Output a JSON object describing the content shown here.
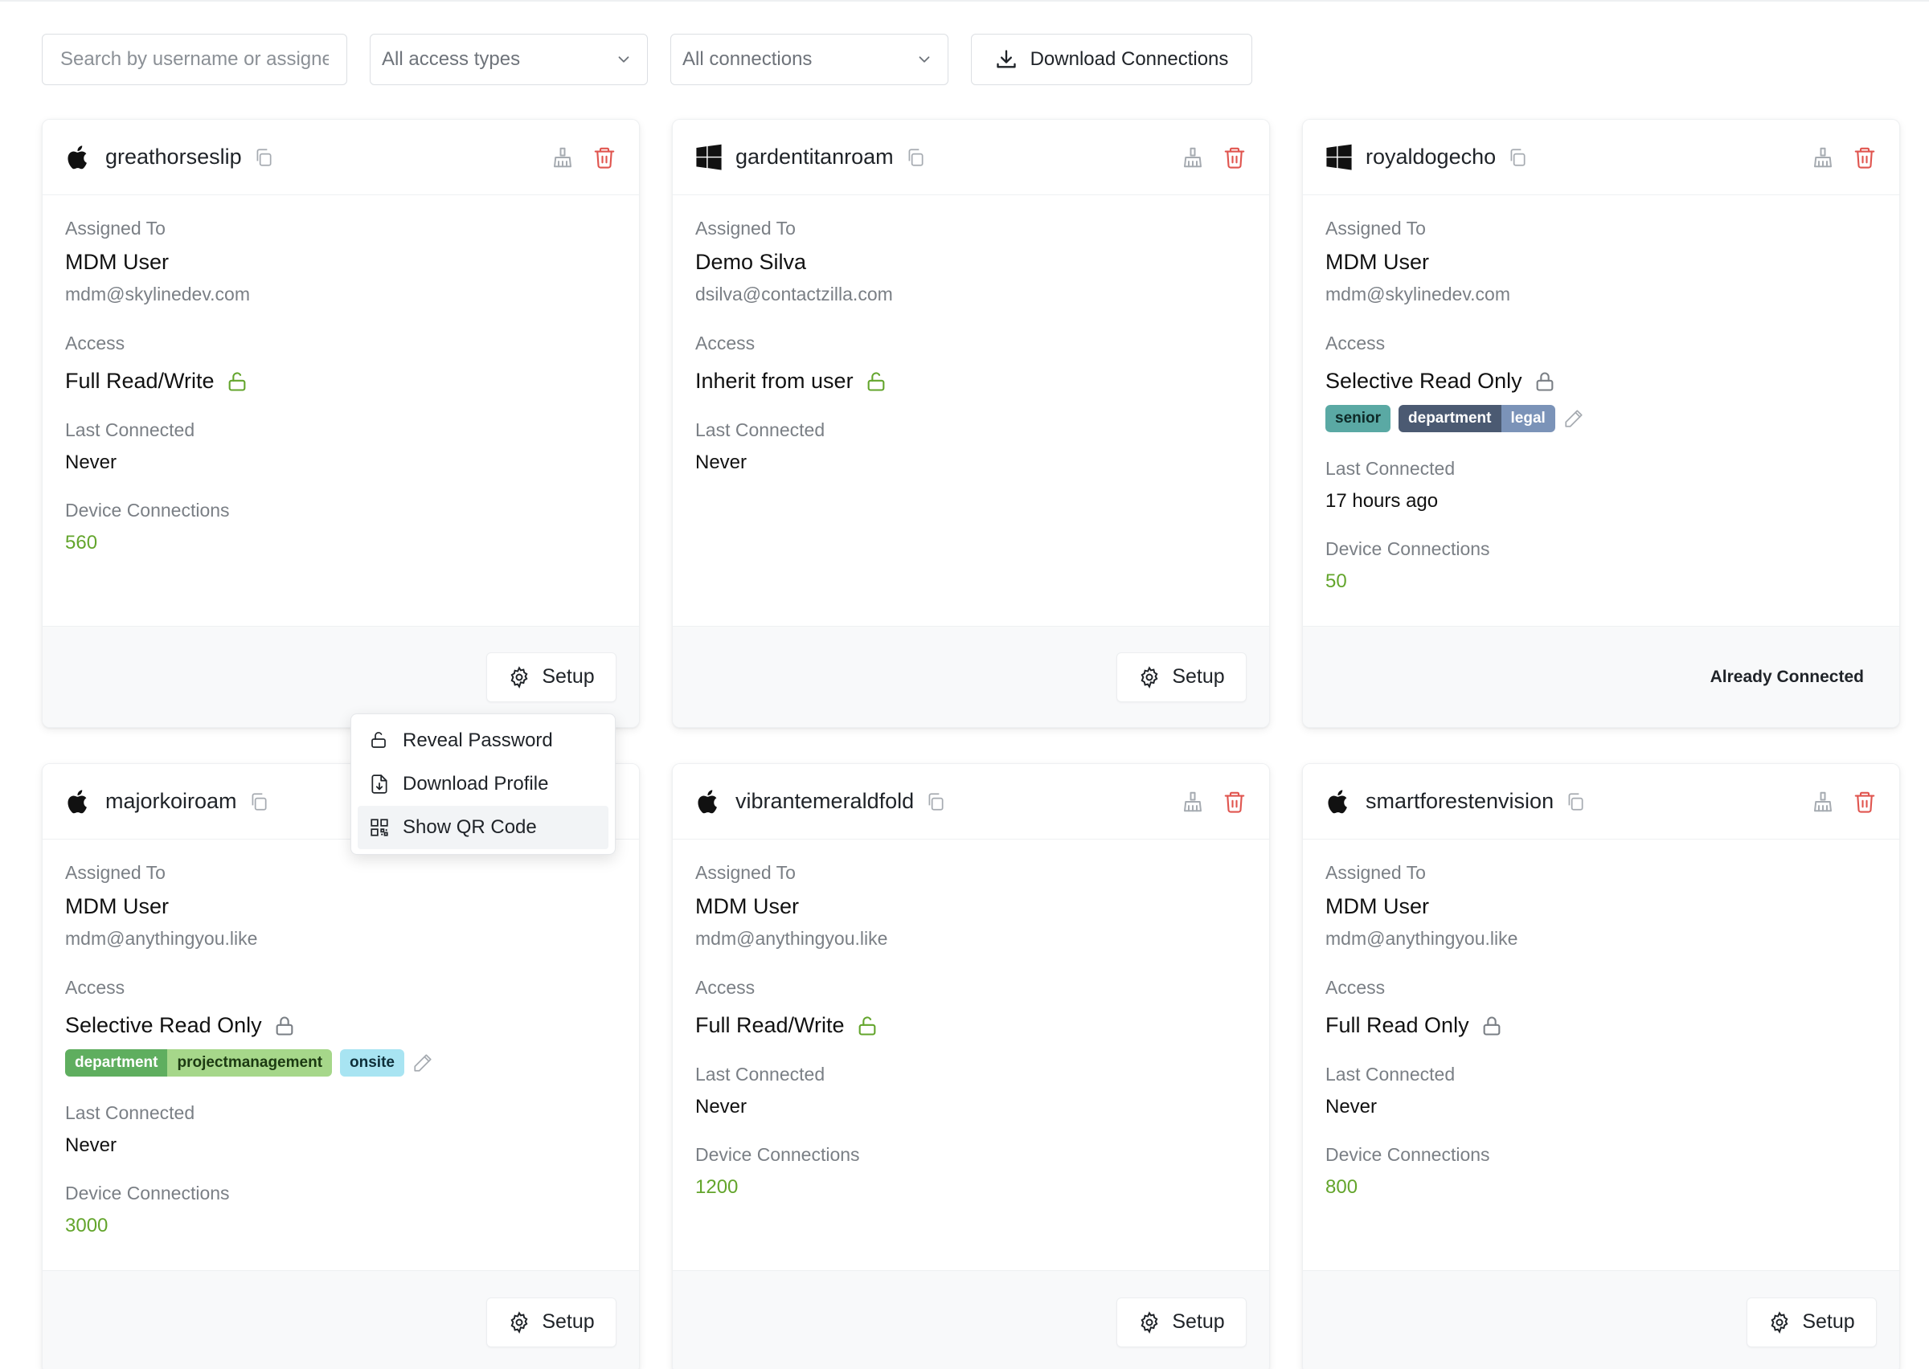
{
  "toolbar": {
    "search_placeholder": "Search by username or assignee",
    "access_filter": "All access types",
    "connection_filter": "All connections",
    "download_label": "Download Connections"
  },
  "labels": {
    "assigned_to": "Assigned To",
    "access": "Access",
    "last_connected": "Last Connected",
    "device_connections": "Device Connections",
    "setup": "Setup",
    "already_connected": "Already Connected"
  },
  "colors": {
    "count_green": "#63a52c",
    "unlocked_green": "#63a52c",
    "locked_gray": "#7a7f85",
    "delete_red": "#e0554f"
  },
  "cards": [
    {
      "os": "apple-icon",
      "username": "greathorseslip",
      "assigned_name": "MDM User",
      "assigned_email": "mdm@skylinedev.com",
      "access": "Full Read/Write",
      "access_locked": false,
      "last_connected": "Never",
      "device_connections": "560"
    },
    {
      "os": "windows-icon",
      "username": "gardentitanroam",
      "assigned_name": "Demo Silva",
      "assigned_email": "dsilva@contactzilla.com",
      "access": "Inherit from user",
      "access_locked": false,
      "last_connected": "Never"
    },
    {
      "os": "windows-icon",
      "username": "royaldogecho",
      "assigned_name": "MDM User",
      "assigned_email": "mdm@skylinedev.com",
      "access": "Selective Read Only",
      "access_locked": true,
      "tags": [
        "senior",
        "department",
        "legal"
      ],
      "last_connected": "17 hours ago",
      "device_connections": "50",
      "already_connected": true
    },
    {
      "os": "apple-icon",
      "username": "majorkoiroam",
      "assigned_name": "MDM User",
      "assigned_email": "mdm@anythingyou.like",
      "access": "Selective Read Only",
      "access_locked": true,
      "tags": [
        "department",
        "projectmanagement",
        "onsite"
      ],
      "last_connected": "Never",
      "device_connections": "3000"
    },
    {
      "os": "apple-icon",
      "username": "vibrantemeraldfold",
      "assigned_name": "MDM User",
      "assigned_email": "mdm@anythingyou.like",
      "access": "Full Read/Write",
      "access_locked": false,
      "last_connected": "Never",
      "device_connections": "1200"
    },
    {
      "os": "apple-icon",
      "username": "smartforestenvision",
      "assigned_name": "MDM User",
      "assigned_email": "mdm@anythingyou.like",
      "access": "Full Read Only",
      "access_locked": true,
      "last_connected": "Never",
      "device_connections": "800"
    }
  ],
  "menu": {
    "items": [
      "Reveal Password",
      "Download Profile",
      "Show QR Code"
    ]
  }
}
